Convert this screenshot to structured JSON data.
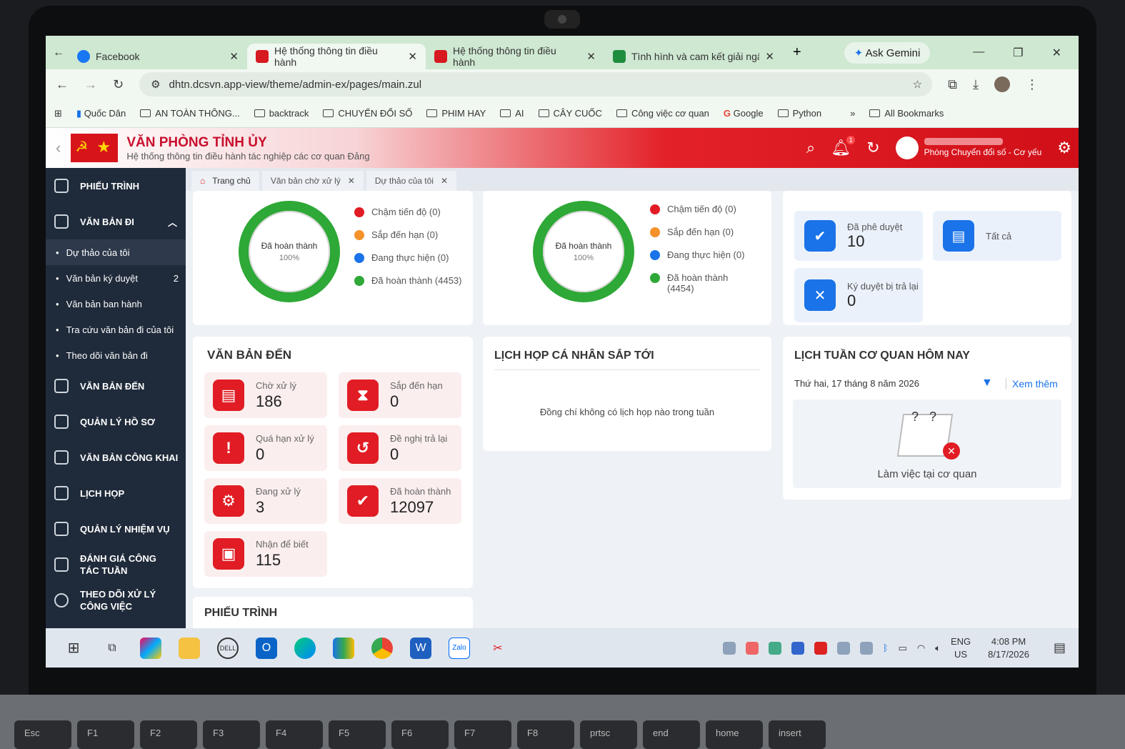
{
  "browser": {
    "tabs": [
      {
        "title": "Facebook",
        "icon": "facebook"
      },
      {
        "title": "Hệ thống thông tin điều hành",
        "icon": "party-flag"
      },
      {
        "title": "Hệ thống thông tin điều hành",
        "icon": "party-flag"
      },
      {
        "title": "Tình hình và cam kết giải ngân",
        "icon": "sheets"
      }
    ],
    "gemini": "Ask Gemini",
    "url": "dhtn.dcsvn.app-view/theme/admin-ex/pages/main.zul",
    "bookmarks": [
      "Quốc Dân",
      "AN TOÀN THÔNG...",
      "backtrack",
      "CHUYỂN ĐỔI SỐ",
      "PHIM HAY",
      "AI",
      "CÂY CUỐC",
      "Công việc cơ quan",
      "Google",
      "Python"
    ],
    "all_bookmarks": "All Bookmarks"
  },
  "app": {
    "title": "VĂN PHÒNG TỈNH ỦY",
    "subtitle": "Hệ thống thông tin điều hành tác nghiệp các cơ quan Đảng",
    "user_dept": "Phòng Chuyển đổi số - Cơ yếu",
    "notif_count": "1"
  },
  "sidebar": {
    "items": [
      {
        "label": "PHIẾU TRÌNH"
      },
      {
        "label": "VĂN BẢN ĐI"
      },
      {
        "label": "VĂN BẢN ĐẾN"
      },
      {
        "label": "QUẢN LÝ HỒ SƠ"
      },
      {
        "label": "VĂN BẢN CÔNG KHAI"
      },
      {
        "label": "LỊCH HỌP"
      },
      {
        "label": "QUẢN LÝ NHIỆM VỤ"
      },
      {
        "label": "ĐÁNH GIÁ CÔNG TÁC TUẦN"
      },
      {
        "label": "THEO DÕI XỬ LÝ CÔNG VIỆC"
      }
    ],
    "subitems": [
      {
        "label": "Dự thảo của tôi"
      },
      {
        "label": "Văn bản ký duyệt",
        "count": "2"
      },
      {
        "label": "Văn bản ban hành"
      },
      {
        "label": "Tra cứu văn bản đi của tôi"
      },
      {
        "label": "Theo dõi văn bản đi"
      }
    ]
  },
  "content_tabs": [
    "Trang chủ",
    "Văn bản chờ xử lý",
    "Dự thảo của tôi"
  ],
  "donut1": {
    "label": "Đã hoàn thành",
    "pct": "100%",
    "completed_fraction": 1.0,
    "legend": [
      "Chậm tiến độ (0)",
      "Sắp đến hạn (0)",
      "Đang thực hiện (0)",
      "Đã hoàn thành (4453)"
    ]
  },
  "donut2": {
    "label": "Đã hoàn thành",
    "pct": "100%",
    "completed_fraction": 1.0,
    "legend": [
      "Chậm tiến độ (0)",
      "Sắp đến hạn (0)",
      "Đang thực hiện (0)",
      "Đã hoàn thành (4454)"
    ]
  },
  "legend_colors": [
    "#e11c24",
    "#f5922a",
    "#1a73e8",
    "#2ea836"
  ],
  "approvals": [
    {
      "label": "Đã phê duyệt",
      "value": "10"
    },
    {
      "label": "Tất cả",
      "value": ""
    },
    {
      "label": "Ký duyệt bị trả lại",
      "value": "0"
    }
  ],
  "incoming": {
    "title": "VĂN BẢN ĐẾN",
    "stats": [
      {
        "label": "Chờ xử lý",
        "value": "186"
      },
      {
        "label": "Sắp đến hạn",
        "value": "0"
      },
      {
        "label": "Quá hạn xử lý",
        "value": "0"
      },
      {
        "label": "Đề nghị trả lại",
        "value": "0"
      },
      {
        "label": "Đang xử lý",
        "value": "3"
      },
      {
        "label": "Đã hoàn thành",
        "value": "12097"
      },
      {
        "label": "Nhận để biết",
        "value": "115"
      }
    ]
  },
  "meetings": {
    "title": "LỊCH HỌP CÁ NHÂN SẮP TỚI",
    "empty": "Đồng chí không có lịch họp nào trong tuần"
  },
  "week": {
    "title": "LỊCH TUẦN CƠ QUAN HÔM NAY",
    "date": "Thứ hai, 17 tháng 8 năm 2026",
    "more": "Xem thêm",
    "status": "Làm việc tại cơ quan"
  },
  "proposal": {
    "title": "PHIẾU TRÌNH"
  },
  "taskbar": {
    "lang1": "ENG",
    "lang2": "US",
    "time": "4:08 PM",
    "date": "8/17/2026"
  },
  "keyboard": [
    "Esc",
    "F1",
    "F2",
    "F3",
    "F4",
    "F5",
    "F6",
    "F7",
    "F8",
    "prtsc",
    "end",
    "home",
    "insert"
  ]
}
